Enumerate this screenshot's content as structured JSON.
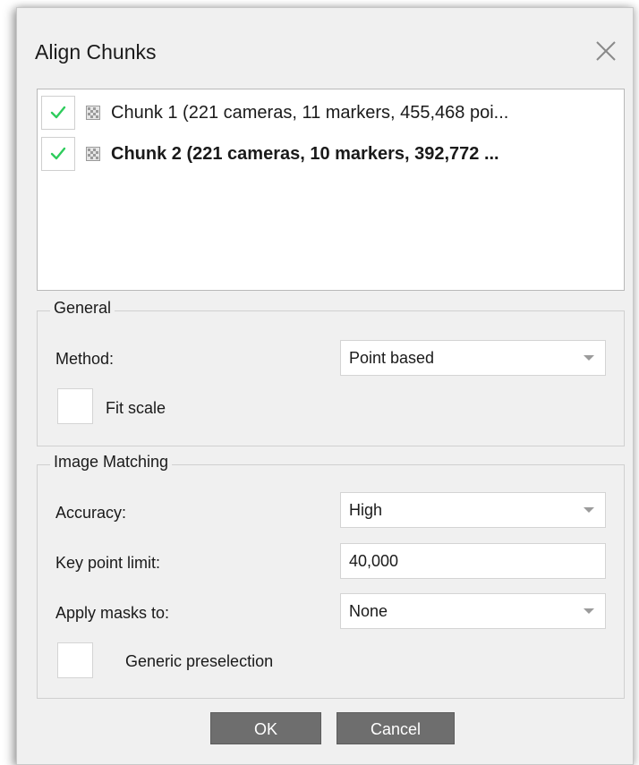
{
  "dialog": {
    "title": "Align Chunks",
    "close_icon": "close-icon"
  },
  "chunks": [
    {
      "checked": true,
      "label": "Chunk 1 (221 cameras, 11 markers, 455,468 poi...",
      "bold": false
    },
    {
      "checked": true,
      "label": "Chunk 2 (221 cameras, 10 markers, 392,772 ...",
      "bold": true
    }
  ],
  "general": {
    "title": "General",
    "method_label": "Method:",
    "method_value": "Point based",
    "fit_scale_label": "Fit scale",
    "fit_scale_checked": false
  },
  "image_matching": {
    "title": "Image Matching",
    "accuracy_label": "Accuracy:",
    "accuracy_value": "High",
    "key_point_limit_label": "Key point limit:",
    "key_point_limit_value": "40,000",
    "apply_masks_label": "Apply masks to:",
    "apply_masks_value": "None",
    "generic_preselection_label": "Generic preselection",
    "generic_preselection_checked": false
  },
  "buttons": {
    "ok": "OK",
    "cancel": "Cancel"
  },
  "colors": {
    "check_green": "#2ecc5c",
    "button_bg": "#6e6e6e",
    "dialog_bg": "#f0f0f0"
  }
}
